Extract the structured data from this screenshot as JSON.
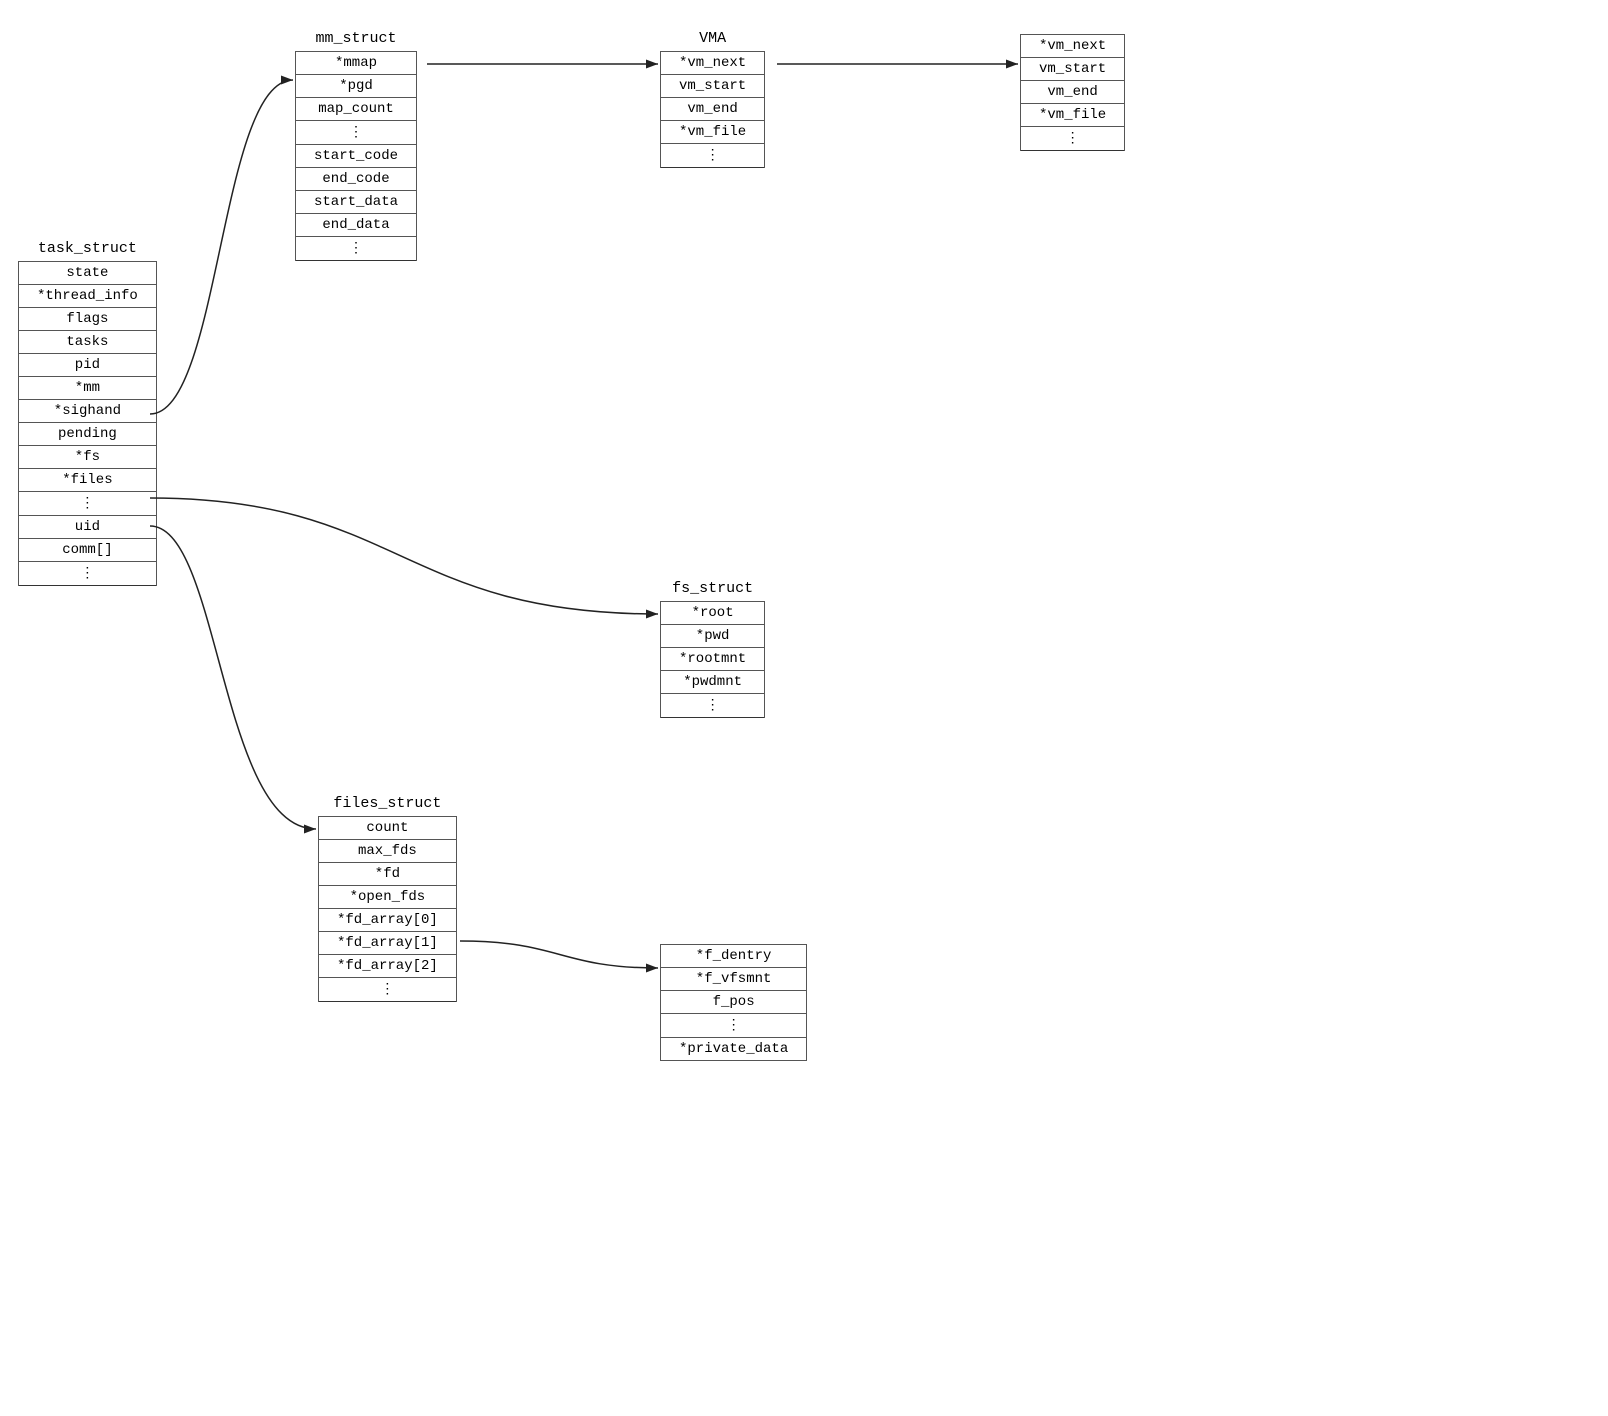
{
  "task_struct": {
    "title": "task_struct",
    "fields": [
      "state",
      "*thread_info",
      "flags",
      "tasks",
      "pid",
      "*mm",
      "*sighand",
      "pending",
      "*fs",
      "*files",
      "⋮",
      "uid",
      "comm[]",
      "⋮"
    ]
  },
  "mm_struct": {
    "title": "mm_struct",
    "fields": [
      "*mmap",
      "*pgd",
      "map_count",
      "⋮",
      "start_code",
      "end_code",
      "start_data",
      "end_data",
      "⋮"
    ]
  },
  "vma1": {
    "title": "VMA",
    "fields": [
      "*vm_next",
      "vm_start",
      "vm_end",
      "*vm_file",
      "⋮"
    ]
  },
  "vma2": {
    "title": "",
    "fields": [
      "*vm_next",
      "vm_start",
      "vm_end",
      "*vm_file",
      "⋮"
    ]
  },
  "fs_struct": {
    "title": "fs_struct",
    "fields": [
      "*root",
      "*pwd",
      "*rootmnt",
      "*pwdmnt",
      "⋮"
    ]
  },
  "files_struct": {
    "title": "files_struct",
    "fields": [
      "count",
      "max_fds",
      "*fd",
      "*open_fds",
      "*fd_array[0]",
      "*fd_array[1]",
      "*fd_array[2]",
      "⋮"
    ]
  },
  "file": {
    "title": "",
    "fields": [
      "*f_dentry",
      "*f_vfsmnt",
      "f_pos",
      "⋮",
      "*private_data"
    ]
  }
}
